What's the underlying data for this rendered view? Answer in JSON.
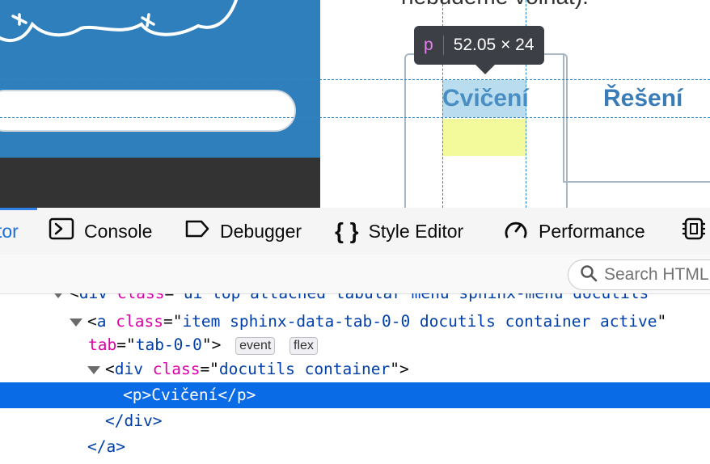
{
  "preview": {
    "top_text": "nebudeme volnat).",
    "tab_exercise": "Cvičení",
    "tab_solution": "Řešení",
    "tooltip": {
      "tag": "p",
      "size": "52.05 × 24"
    }
  },
  "devtools": {
    "tabs": [
      {
        "label": "tor",
        "icon": "inspector-icon",
        "active": true
      },
      {
        "label": "Console",
        "icon": "console-icon"
      },
      {
        "label": "Debugger",
        "icon": "debugger-icon"
      },
      {
        "label": "Style Editor",
        "icon": "braces-icon"
      },
      {
        "label": "Performance",
        "icon": "gauge-icon"
      }
    ],
    "search_placeholder": "Search HTML",
    "markup": {
      "line0": {
        "tag": "div",
        "attr": "class",
        "value": "ui top attached tabular menu sphinx-menu docutils"
      },
      "line1": {
        "tag": "a",
        "attr": "class",
        "value": "item sphinx-data-tab-0-0 docutils container active"
      },
      "line2": {
        "attr": "tab",
        "value": "tab-0-0",
        "badges": [
          "event",
          "flex"
        ]
      },
      "line3": {
        "tag": "div",
        "attr": "class",
        "value": "docutils container"
      },
      "line4": {
        "html": "<p>Cvičení</p>"
      },
      "line5": {
        "html": "</div>"
      },
      "line6": {
        "html": "</a>"
      }
    }
  },
  "colors": {
    "selection": "#0a6be6",
    "tag_name": "#003eaa",
    "attr_name": "#dd00a9",
    "preview_blue": "#2f7fbd",
    "highlight_yellow": "#f3fa9c"
  }
}
